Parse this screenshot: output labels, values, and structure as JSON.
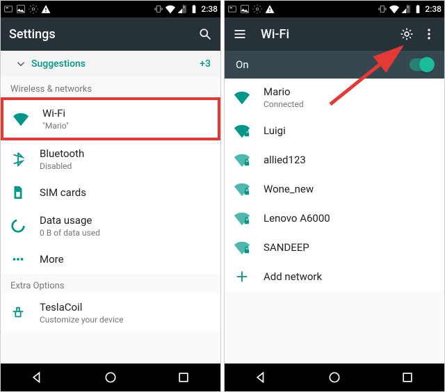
{
  "status": {
    "time": "2:38"
  },
  "left": {
    "title": "Settings",
    "suggestions": {
      "label": "Suggestions",
      "count": "+3"
    },
    "section1": "Wireless & networks",
    "wifi": {
      "label": "Wi-Fi",
      "sub": "\"Mario\""
    },
    "bluetooth": {
      "label": "Bluetooth",
      "sub": "Disabled"
    },
    "sim": {
      "label": "SIM cards"
    },
    "data": {
      "label": "Data usage",
      "sub": "0 B of data used"
    },
    "more": {
      "label": "More"
    },
    "section2": "Extra Options",
    "tesla": {
      "label": "TeslaCoil",
      "sub": "Customize your device"
    }
  },
  "right": {
    "title": "Wi-Fi",
    "on": "On",
    "networks": [
      {
        "name": "Mario",
        "sub": "Connected"
      },
      {
        "name": "Luigi"
      },
      {
        "name": "allied123"
      },
      {
        "name": "Wone_new"
      },
      {
        "name": "Lenovo A6000"
      },
      {
        "name": "SANDEEP"
      }
    ],
    "add": "Add network"
  }
}
